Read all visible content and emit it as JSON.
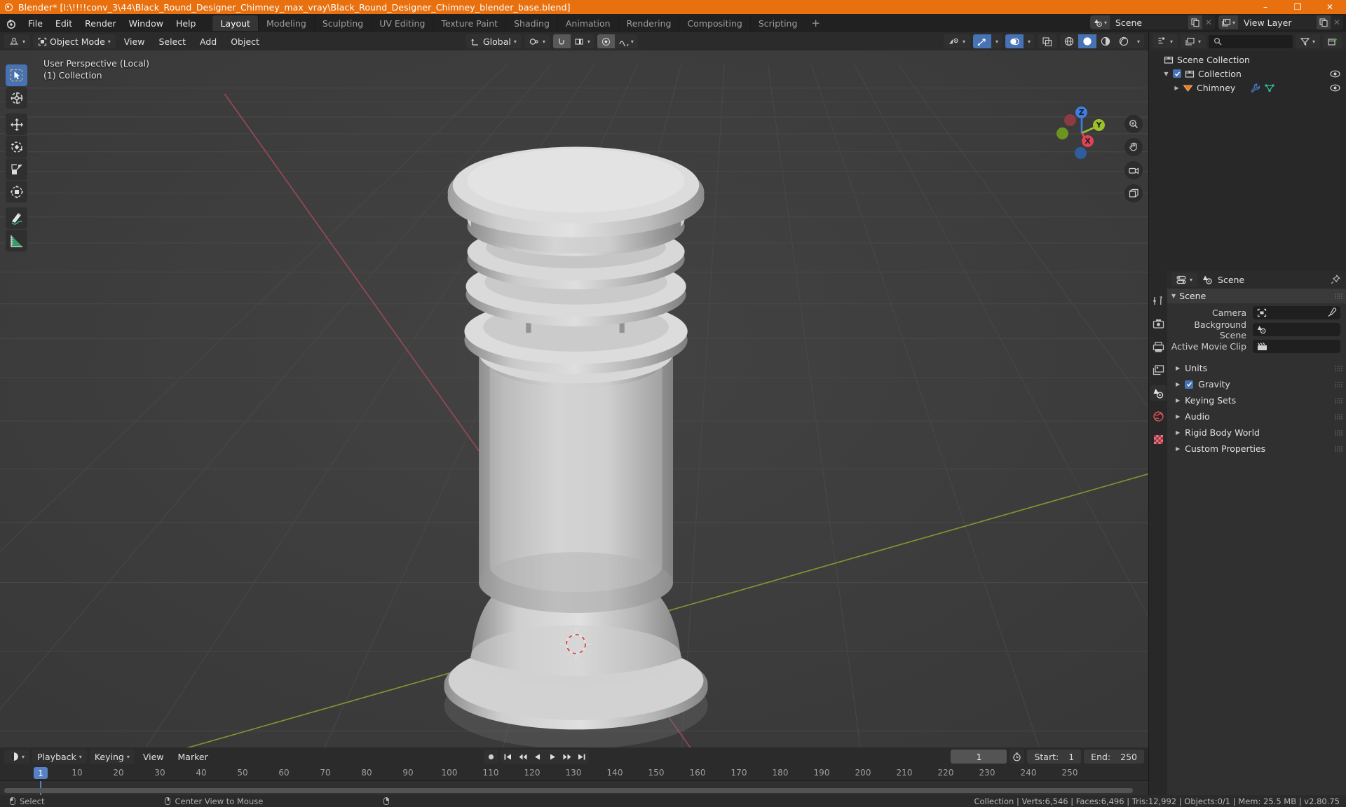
{
  "window": {
    "title": "Blender* [I:\\!!!!conv_3\\44\\Black_Round_Designer_Chimney_max_vray\\Black_Round_Designer_Chimney_blender_base.blend]",
    "minimize": "–",
    "maximize": "❐",
    "close": "✕"
  },
  "topbar": {
    "menus": [
      "File",
      "Edit",
      "Render",
      "Window",
      "Help"
    ],
    "workspaces": [
      {
        "label": "Layout",
        "active": true
      },
      {
        "label": "Modeling",
        "active": false
      },
      {
        "label": "Sculpting",
        "active": false
      },
      {
        "label": "UV Editing",
        "active": false
      },
      {
        "label": "Texture Paint",
        "active": false
      },
      {
        "label": "Shading",
        "active": false
      },
      {
        "label": "Animation",
        "active": false
      },
      {
        "label": "Rendering",
        "active": false
      },
      {
        "label": "Compositing",
        "active": false
      },
      {
        "label": "Scripting",
        "active": false
      }
    ],
    "add_workspace": "+",
    "scene_name": "Scene",
    "view_layer_name": "View Layer"
  },
  "viewport": {
    "mode": "Object Mode",
    "menus": [
      "View",
      "Select",
      "Add",
      "Object"
    ],
    "transform_orientation": "Global",
    "overlay_line1": "User Perspective (Local)",
    "overlay_line2": "(1) Collection",
    "gizmo": {
      "x": "X",
      "y": "Y",
      "z": "Z"
    },
    "tools": [
      {
        "name": "select-box-tool",
        "active": true
      },
      {
        "name": "cursor-tool",
        "active": false
      },
      {
        "name": "move-tool",
        "active": false
      },
      {
        "name": "rotate-tool",
        "active": false
      },
      {
        "name": "scale-tool",
        "active": false
      },
      {
        "name": "transform-tool",
        "active": false
      },
      {
        "name": "annotate-tool",
        "active": false
      },
      {
        "name": "measure-tool",
        "active": false
      }
    ],
    "shading_modes": [
      "wireframe",
      "solid",
      "material-preview",
      "rendered"
    ],
    "shading_active": "solid"
  },
  "outliner": {
    "search_placeholder": "",
    "rows": [
      {
        "label": "Scene Collection",
        "indent": 0,
        "icon": "collection-icon",
        "disclosure": "",
        "checkbox": false,
        "eye": false
      },
      {
        "label": "Collection",
        "indent": 1,
        "icon": "collection-icon",
        "disclosure": "▼",
        "checkbox": true,
        "eye": true
      },
      {
        "label": "Chimney",
        "indent": 2,
        "icon": "mesh-object-icon",
        "disclosure": "▶",
        "checkbox": false,
        "eye": true
      }
    ]
  },
  "properties": {
    "tab_name": "Scene",
    "panel_title": "Scene",
    "fields": [
      {
        "label": "Camera",
        "value": "",
        "icon": "camera-icon",
        "eyedropper": true
      },
      {
        "label": "Background Scene",
        "value": "",
        "icon": "scene-icon",
        "eyedropper": false
      },
      {
        "label": "Active Movie Clip",
        "value": "",
        "icon": "clip-icon",
        "eyedropper": false
      }
    ],
    "sections": [
      {
        "label": "Units",
        "checkbox": null
      },
      {
        "label": "Gravity",
        "checkbox": true
      },
      {
        "label": "Keying Sets",
        "checkbox": null
      },
      {
        "label": "Audio",
        "checkbox": null
      },
      {
        "label": "Rigid Body World",
        "checkbox": null
      },
      {
        "label": "Custom Properties",
        "checkbox": null
      }
    ],
    "tabs": [
      {
        "name": "tool-tab",
        "active": false
      },
      {
        "name": "render-tab",
        "active": false
      },
      {
        "name": "output-tab",
        "active": false
      },
      {
        "name": "view-layer-tab",
        "active": false
      },
      {
        "name": "scene-tab",
        "active": true
      },
      {
        "name": "world-tab",
        "active": false
      },
      {
        "name": "texture-tab",
        "active": false
      }
    ]
  },
  "timeline": {
    "menus": [
      "Playback",
      "Keying",
      "View",
      "Marker"
    ],
    "current_frame": "1",
    "start_label": "Start:",
    "start_value": "1",
    "end_label": "End:",
    "end_value": "250",
    "ruler_ticks": [
      10,
      20,
      30,
      40,
      50,
      60,
      70,
      80,
      90,
      100,
      110,
      120,
      130,
      140,
      150,
      160,
      170,
      180,
      190,
      200,
      210,
      220,
      230,
      240,
      250
    ]
  },
  "statusbar": {
    "hint1": "Select",
    "hint2": "Center View to Mouse",
    "stats": "Collection | Verts:6,546 | Faces:6,496 | Tris:12,992 | Objects:0/1 | Mem: 25.5 MB | v2.80.75"
  },
  "colors": {
    "accent_orange": "#e8700f",
    "accent_blue": "#4772b3",
    "axis_x": "#e0425a",
    "axis_y": "#9cc22a",
    "axis_z": "#3e7ee0",
    "viewport_bg": "#3b3b3b",
    "model_grey": "#c8c8c8"
  }
}
